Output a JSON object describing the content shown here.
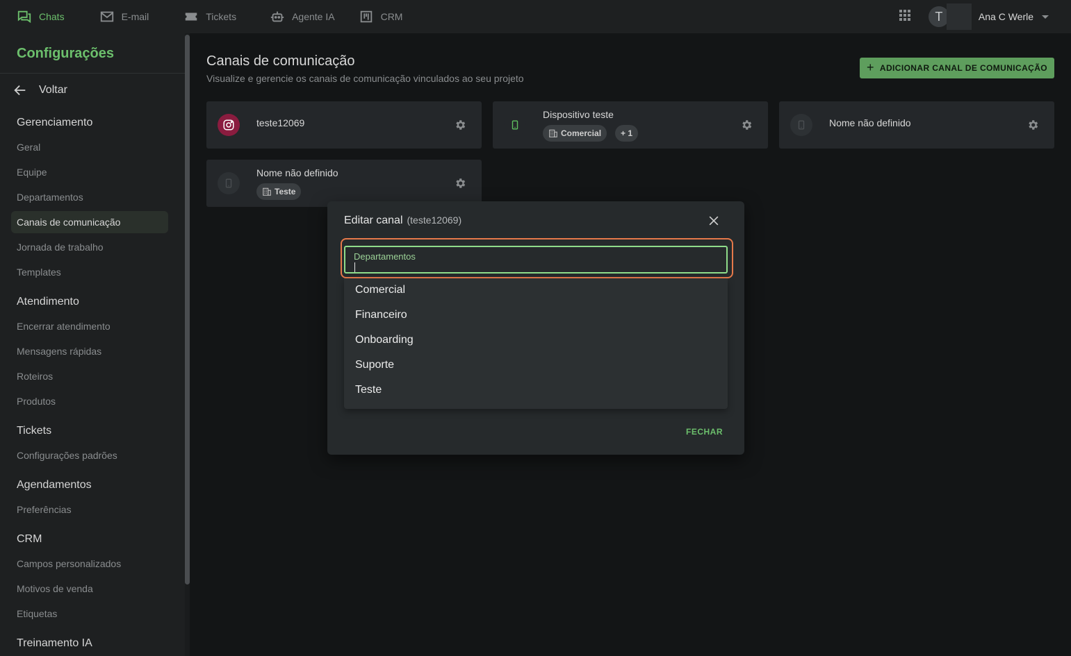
{
  "topbar": {
    "nav": [
      {
        "label": "Chats",
        "icon": "chat-icon",
        "active": true
      },
      {
        "label": "E-mail",
        "icon": "mail-icon"
      },
      {
        "label": "Tickets",
        "icon": "ticket-icon"
      },
      {
        "label": "Agente IA",
        "icon": "robot-icon"
      },
      {
        "label": "CRM",
        "icon": "kanban-icon"
      }
    ],
    "user": {
      "initial": "T",
      "name": "Ana C Werle"
    }
  },
  "sidebar": {
    "title": "Configurações",
    "back_label": "Voltar",
    "sections": [
      {
        "heading": "Gerenciamento",
        "items": [
          "Geral",
          "Equipe",
          "Departamentos",
          "Canais de comunicação",
          "Jornada de trabalho",
          "Templates"
        ]
      },
      {
        "heading": "Atendimento",
        "items": [
          "Encerrar atendimento",
          "Mensagens rápidas",
          "Roteiros",
          "Produtos"
        ]
      },
      {
        "heading": "Tickets",
        "items": [
          "Configurações padrões"
        ]
      },
      {
        "heading": "Agendamentos",
        "items": [
          "Preferências"
        ]
      },
      {
        "heading": "CRM",
        "items": [
          "Campos personalizados",
          "Motivos de venda",
          "Etiquetas"
        ]
      },
      {
        "heading": "Treinamento IA",
        "items": []
      }
    ],
    "active_item": "Canais de comunicação"
  },
  "main": {
    "title": "Canais de comunicação",
    "subtitle": "Visualize e gerencie os canais de comunicação vinculados ao seu projeto",
    "add_button": "ADICIONAR CANAL DE COMUNICAÇÃO",
    "channels": [
      {
        "name": "teste12069",
        "icon": "instagram-icon",
        "tags": []
      },
      {
        "name": "Dispositivo teste",
        "icon": "phone-icon",
        "tags": [
          "Comercial",
          "+ 1"
        ]
      },
      {
        "name": "Nome não definido",
        "icon": "phone-icon",
        "tags": []
      },
      {
        "name": "Nome não definido",
        "icon": "phone-icon",
        "tags": [
          "Teste"
        ]
      }
    ]
  },
  "modal": {
    "title": "Editar canal",
    "subtitle": "(teste12069)",
    "field_label": "Departamentos",
    "field_value": "",
    "options": [
      "Comercial",
      "Financeiro",
      "Onboarding",
      "Suporte",
      "Teste"
    ],
    "close_button": "FECHAR"
  },
  "colors": {
    "accent": "#6cbf6c",
    "highlight": "#e6794a",
    "instagram": "#8a1c3f"
  }
}
